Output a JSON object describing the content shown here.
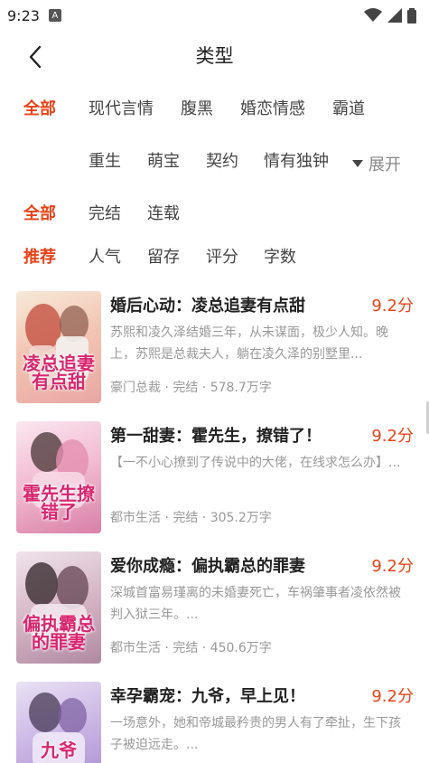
{
  "status": {
    "time": "9:23",
    "a_icon": "A"
  },
  "header": {
    "title": "类型"
  },
  "filters": {
    "category_all": "全部",
    "categories": [
      "现代言情",
      "腹黑",
      "婚恋情感",
      "霸道",
      "重生",
      "萌宝",
      "契约",
      "情有独钟"
    ],
    "expand_label": "展开",
    "status_all": "全部",
    "status_options": [
      "完结",
      "连载"
    ],
    "sort_active": "推荐",
    "sort_options": [
      "人气",
      "留存",
      "评分",
      "字数"
    ]
  },
  "books": [
    {
      "title": "婚后心动：凌总追妻有点甜",
      "score": "9.2分",
      "desc": "苏熙和凌久泽结婚三年，从未谋面，极少人知。晚上，苏熙是总裁夫人，躺在凌久泽的别墅里...",
      "meta": "豪门总裁 · 完结 · 578.7万字",
      "cover_text": "凌总追妻有点甜"
    },
    {
      "title": "第一甜妻：霍先生，撩错了！",
      "score": "9.2分",
      "desc": "【一不小心撩到了传说中的大佬，在线求怎么办】...",
      "meta": "都市生活 · 完结 · 305.2万字",
      "cover_text": "霍先生撩错了"
    },
    {
      "title": "爱你成瘾：偏执霸总的罪妻",
      "score": "9.2分",
      "desc": "深城首富易瑾离的未婚妻死亡，车祸肇事者凌依然被判入狱三年。...",
      "meta": "都市生活 · 完结 · 450.6万字",
      "cover_text": "偏执霸总的罪妻"
    },
    {
      "title": "幸孕霸宠：九爷，早上见！",
      "score": "9.2分",
      "desc": "一场意外，她和帝城最矜贵的男人有了牵扯，生下孩子被迫远走。...",
      "meta": "",
      "cover_text": "九爷"
    }
  ],
  "colors": {
    "accent": "#e94318",
    "text": "#222222",
    "muted": "#999999"
  }
}
